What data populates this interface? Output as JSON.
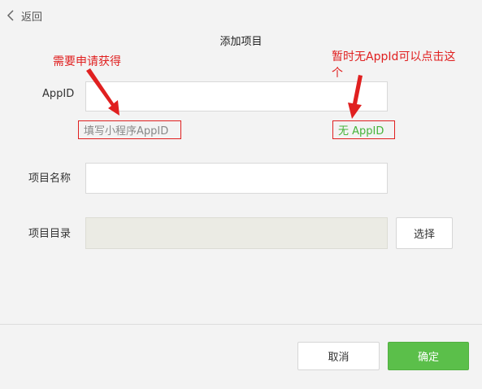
{
  "header": {
    "back_label": "返回",
    "title": "添加项目"
  },
  "form": {
    "appid_label": "AppID",
    "appid_value": "",
    "appid_hint": "填写小程序AppID",
    "no_appid_link": "无 AppID",
    "name_label": "项目名称",
    "name_value": "",
    "dir_label": "项目目录",
    "dir_value": "",
    "choose_button": "选择"
  },
  "footer": {
    "cancel_label": "取消",
    "confirm_label": "确定"
  },
  "annotations": {
    "left_note": "需要申请获得",
    "right_note_line1": "暂时无AppId可以点击这",
    "right_note_line2": "个"
  },
  "colors": {
    "annotation": "#e02020",
    "primary": "#5bbf4a",
    "link": "#46b33a"
  }
}
